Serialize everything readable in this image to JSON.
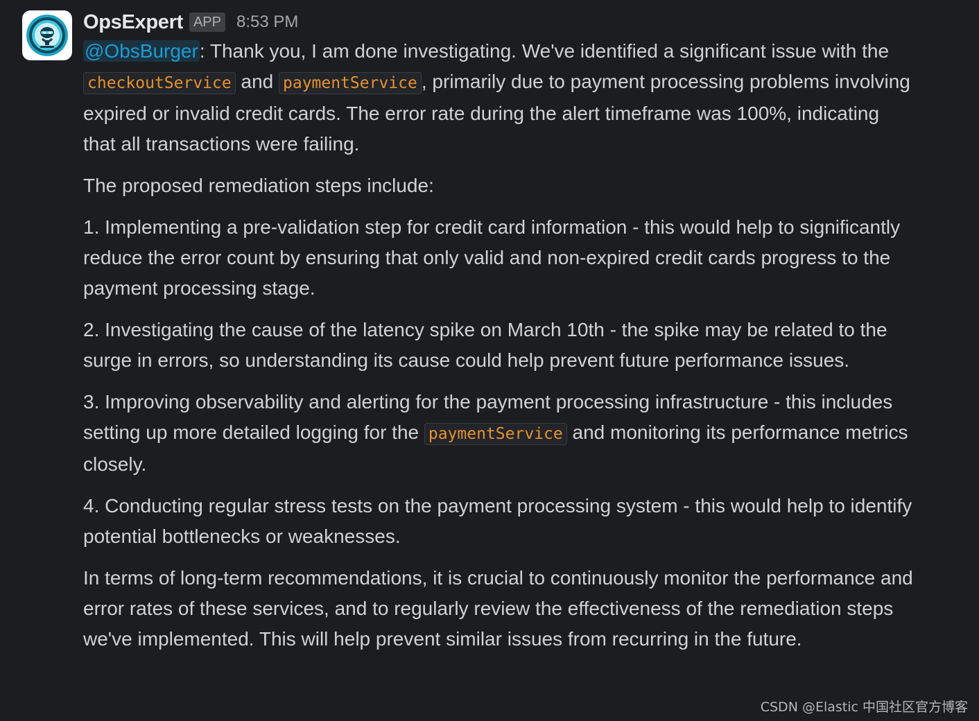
{
  "message": {
    "sender": "OpsExpert",
    "badge": "APP",
    "timestamp": "8:53 PM",
    "avatar_icon": "robot-icon",
    "paragraphs": [
      {
        "mention": "@ObsBurger",
        "text_a": ": Thank you, I am done investigating. We've identified a significant issue with the ",
        "code_a": "checkoutService",
        "text_b": " and ",
        "code_b": "paymentService",
        "text_c": ", primarily due to payment processing problems involving expired or invalid credit cards. The error rate during the alert timeframe was 100%, indicating that all transactions were failing."
      },
      {
        "text": "The proposed remediation steps include:"
      },
      {
        "text": "1. Implementing a pre-validation step for credit card information - this would help to significantly reduce the error count by ensuring that only valid and non-expired credit cards progress to the payment processing stage."
      },
      {
        "text": "2. Investigating the cause of the latency spike on March 10th - the spike may be related to the surge in errors, so understanding its cause could help prevent future performance issues."
      },
      {
        "text_a": "3. Improving observability and alerting for the payment processing infrastructure - this includes setting up more detailed logging for the ",
        "code": "paymentService",
        "text_b": " and monitoring its performance metrics closely."
      },
      {
        "text": "4. Conducting regular stress tests on the payment processing system - this would help to identify potential bottlenecks or weaknesses."
      },
      {
        "text": "In terms of long-term recommendations, it is crucial to continuously monitor the performance and error rates of these services, and to regularly review the effectiveness of the remediation steps we've implemented. This will help prevent similar issues from recurring in the future."
      }
    ]
  },
  "watermark": "CSDN @Elastic 中国社区官方博客",
  "colors": {
    "background": "#1b1d21",
    "text": "#d1d2d3",
    "mention": "#1d9bd1",
    "code": "#e8912d",
    "avatar_ring": "#2bb5d6"
  }
}
